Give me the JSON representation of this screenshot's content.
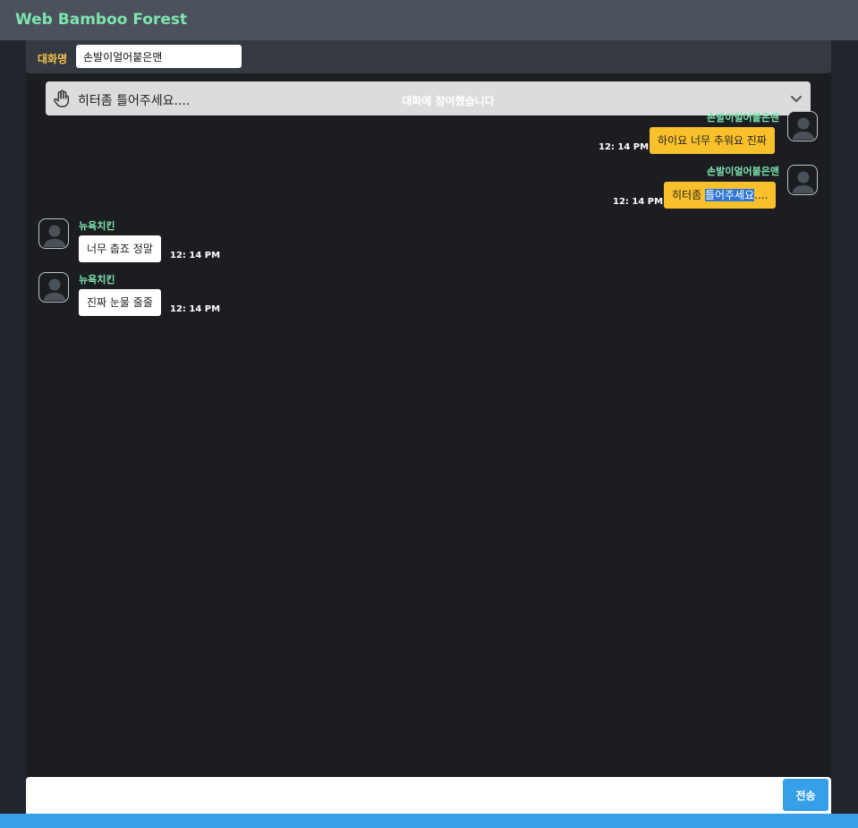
{
  "app": {
    "title": "Web Bamboo Forest",
    "accent": "#7ee4b0"
  },
  "room": {
    "label": "대화명",
    "name": "손발이얼어붙은맨"
  },
  "notice": {
    "text": "히터좀 틀어주세요....",
    "icon": "hand-icon"
  },
  "system": {
    "joined": "대화에 참여했습니다"
  },
  "messages": [
    {
      "sender": "손발이얼어붙은맨",
      "text": "하이요 너무 추워요 진짜",
      "time": "12: 14 PM",
      "mine": true
    },
    {
      "sender": "손발이얼어붙은맨",
      "text_pre": "히터좀 ",
      "text_sel": "틀어주세요",
      "text_post": "....",
      "time": "12: 14 PM",
      "mine": true
    },
    {
      "sender": "뉴욕치킨",
      "text": "너무 춥죠 정말",
      "time": "12: 14 PM",
      "mine": false
    },
    {
      "sender": "뉴욕치킨",
      "text": "진짜 눈물 줄줄",
      "time": "12: 14 PM",
      "mine": false
    }
  ],
  "composer": {
    "placeholder": "",
    "send_label": "전송"
  },
  "colors": {
    "mine_bubble": "#f8c12c",
    "theirs_bubble": "#ffffff",
    "button": "#369fe9"
  }
}
